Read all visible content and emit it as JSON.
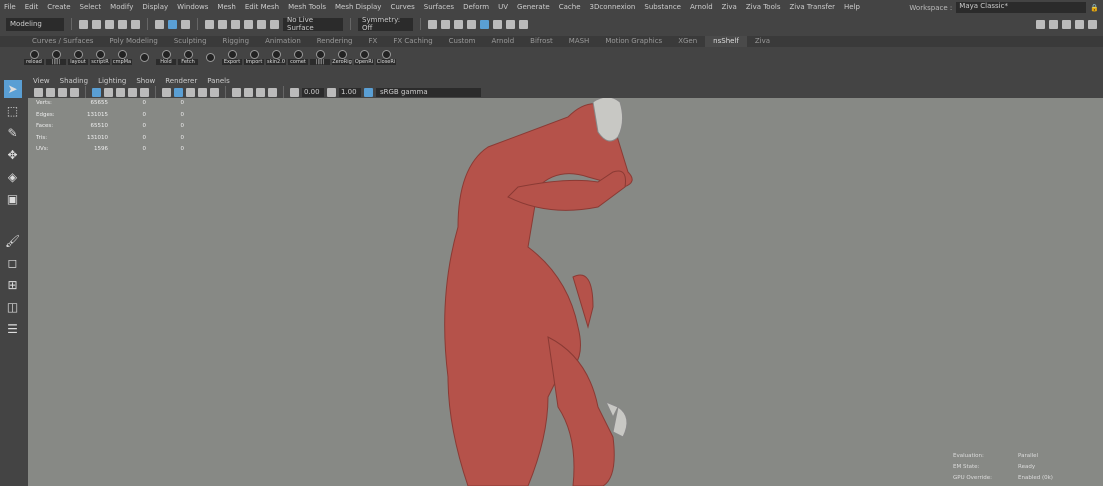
{
  "menu": [
    "File",
    "Edit",
    "Create",
    "Select",
    "Modify",
    "Display",
    "Windows",
    "Mesh",
    "Edit Mesh",
    "Mesh Tools",
    "Mesh Display",
    "Curves",
    "Surfaces",
    "Deform",
    "UV",
    "Generate",
    "Cache",
    "3Dconnexion",
    "Substance",
    "Arnold",
    "Ziva",
    "Ziva Tools",
    "Ziva Transfer",
    "Help"
  ],
  "workspace": {
    "label": "Workspace :",
    "value": "Maya Classic*"
  },
  "toolbar": {
    "mode": "Modeling",
    "live_surface": "No Live Surface",
    "symmetry": "Symmetry: Off"
  },
  "shelf_tabs": [
    "Curves / Surfaces",
    "Poly Modeling",
    "Sculpting",
    "Rigging",
    "Animation",
    "Rendering",
    "FX",
    "FX Caching",
    "Custom",
    "Arnold",
    "Bifrost",
    "MASH",
    "Motion Graphics",
    "XGen",
    "nsShelf",
    "Ziva"
  ],
  "active_shelf": "nsShelf",
  "shelf_buttons": [
    "reload",
    "|||||",
    "layout",
    "scriptR",
    "cmpMa",
    "",
    "Hold",
    "Fetch",
    "",
    "Export",
    "Import",
    "skin2.0",
    "comet",
    "|||||",
    "ZeroRig",
    "OpenRi",
    "CloseRi"
  ],
  "panel_menu": [
    "View",
    "Shading",
    "Lighting",
    "Show",
    "Renderer",
    "Panels"
  ],
  "viewport_toolbar": {
    "exposure": "0.00",
    "gamma": "1.00",
    "color_space": "sRGB gamma"
  },
  "hud": [
    {
      "label": "Verts:",
      "a": "65655",
      "b": "0",
      "c": "0"
    },
    {
      "label": "Edges:",
      "a": "131015",
      "b": "0",
      "c": "0"
    },
    {
      "label": "Faces:",
      "a": "65510",
      "b": "0",
      "c": "0"
    },
    {
      "label": "Tris:",
      "a": "131010",
      "b": "0",
      "c": "0"
    },
    {
      "label": "UVs:",
      "a": "1596",
      "b": "0",
      "c": "0"
    }
  ],
  "eval": [
    {
      "label": "Evaluation:",
      "value": "Parallel"
    },
    {
      "label": "EM State:",
      "value": "Ready"
    },
    {
      "label": "GPU Override:",
      "value": "Enabled (0k)"
    }
  ],
  "colors": {
    "accent": "#5a9fd4",
    "viewport": "#878985",
    "muscle": "#b5524a"
  }
}
